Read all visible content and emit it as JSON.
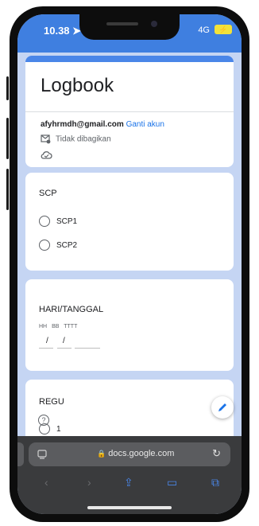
{
  "status_bar": {
    "time": "10.38",
    "network": "4G"
  },
  "form": {
    "title": "Logbook",
    "account_email": "afyhrmdh@gmail.com",
    "switch_account_label": "Ganti akun",
    "share_status": "Tidak dibagikan"
  },
  "questions": {
    "scp": {
      "title": "SCP",
      "options": [
        "SCP1",
        "SCP2"
      ]
    },
    "date": {
      "title": "HARI/TANGGAL",
      "field_labels": [
        "HH",
        "BB",
        "TTTT"
      ],
      "separators": [
        "/",
        "/"
      ]
    },
    "regu": {
      "title": "REGU",
      "options": [
        "1"
      ]
    }
  },
  "browser": {
    "url": "docs.google.com"
  },
  "colors": {
    "accent": "#4a86e8",
    "status_bar": "#3f7fe0",
    "background": "#c5d5f3",
    "link": "#1a73e8",
    "browser_chrome": "#3a3b3d"
  },
  "icons": [
    "navigation-arrow-icon",
    "battery-charging-icon",
    "mail-share-icon",
    "cloud-icon",
    "edit-pencil-icon",
    "help-icon",
    "tabs-icon",
    "lock-icon",
    "reload-icon",
    "back-icon",
    "forward-icon",
    "share-icon",
    "bookmarks-icon",
    "tabs-overview-icon"
  ]
}
